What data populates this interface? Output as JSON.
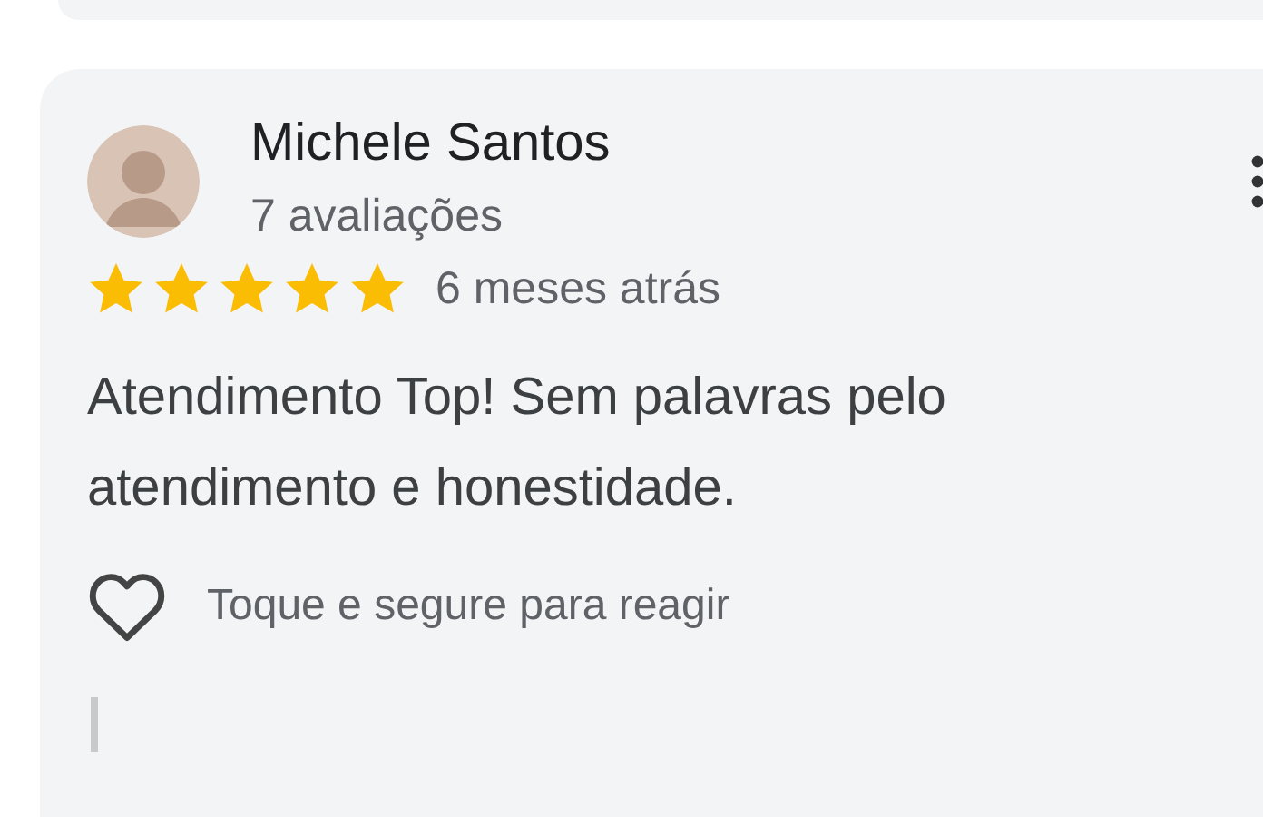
{
  "review": {
    "author": "Michele Santos",
    "review_count": "7 avaliações",
    "stars": 5,
    "time": "6 meses atrás",
    "text": "Atendimento Top! Sem palavras pelo atendimento e honestidade.",
    "react_hint": "Toque e segure para reagir"
  }
}
